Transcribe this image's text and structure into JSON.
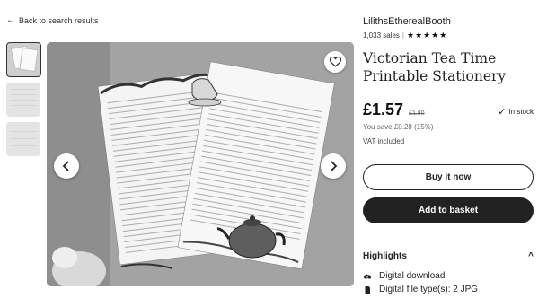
{
  "back_link": {
    "label": "Back to search results",
    "icon": "arrow-left-icon"
  },
  "gallery": {
    "thumbnails": [
      {
        "name": "Victorian tea time stationery preview"
      },
      {
        "name": "listing preview 2"
      },
      {
        "name": "listing preview 3"
      }
    ],
    "prev_icon": "chevron-left-icon",
    "next_icon": "chevron-right-icon",
    "favorite_icon": "heart-icon"
  },
  "listing": {
    "shop_name": "LilithsEtherealBooth",
    "sales": "1,033 sales",
    "rating": 5,
    "title": "Victorian Tea Time Printable Stationery",
    "price": "£1.57",
    "original_price": "£1.80",
    "stock": "In stock",
    "savings": "You save £0.28 (15%)",
    "vat": "VAT included",
    "buy_now_label": "Buy it now",
    "add_to_basket_label": "Add to basket"
  },
  "highlights": {
    "heading": "Highlights",
    "items": [
      {
        "icon": "download-cloud-icon",
        "label": "Digital download"
      },
      {
        "icon": "file-icon",
        "label": "Digital file type(s): 2 JPG"
      }
    ]
  }
}
